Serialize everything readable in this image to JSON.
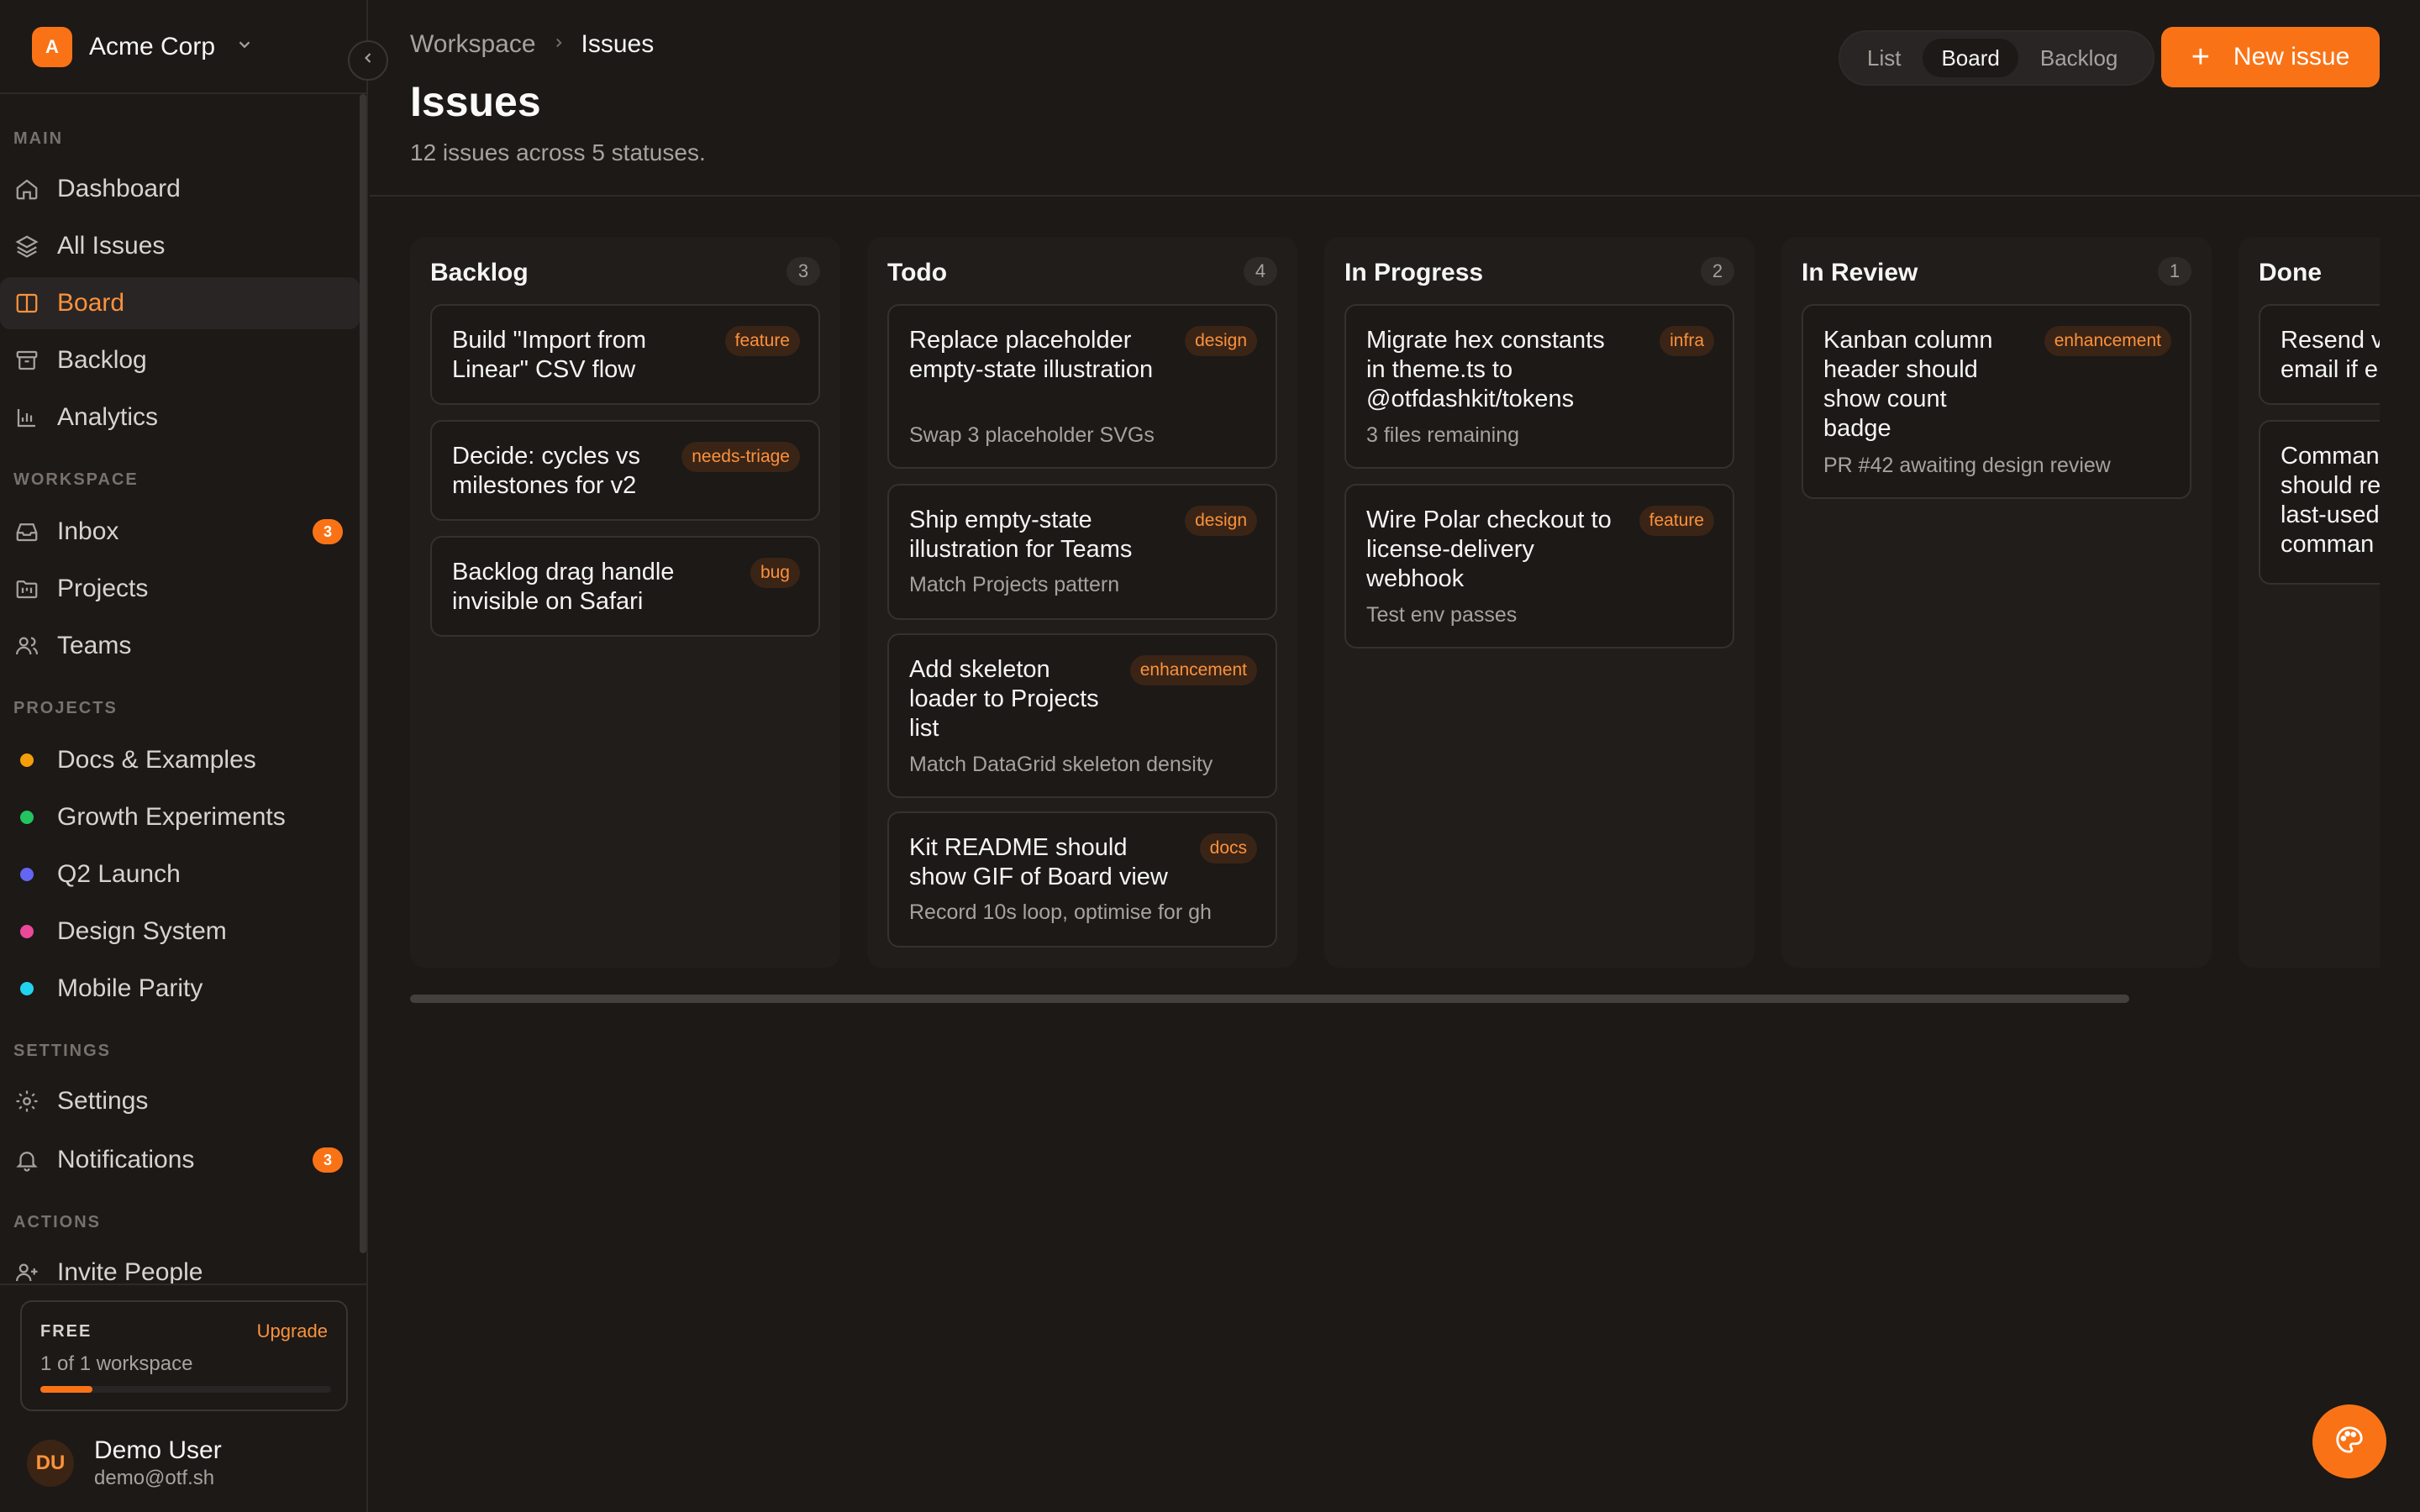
{
  "org": {
    "initial": "A",
    "name": "Acme Corp"
  },
  "sidebar": {
    "sections": {
      "main": "MAIN",
      "workspace": "WORKSPACE",
      "projects": "PROJECTS",
      "settings": "SETTINGS",
      "actions": "ACTIONS"
    },
    "main_items": [
      {
        "label": "Dashboard",
        "icon": "home-icon"
      },
      {
        "label": "All Issues",
        "icon": "layers-icon"
      },
      {
        "label": "Board",
        "icon": "board-icon",
        "active": true
      },
      {
        "label": "Backlog",
        "icon": "archive-icon"
      },
      {
        "label": "Analytics",
        "icon": "bar-chart-icon"
      }
    ],
    "workspace_items": [
      {
        "label": "Inbox",
        "icon": "inbox-icon",
        "badge": "3"
      },
      {
        "label": "Projects",
        "icon": "folder-icon"
      },
      {
        "label": "Teams",
        "icon": "users-icon"
      }
    ],
    "projects": [
      {
        "label": "Docs & Examples",
        "color": "#f59e0b"
      },
      {
        "label": "Growth Experiments",
        "color": "#22c55e"
      },
      {
        "label": "Q2 Launch",
        "color": "#6366f1"
      },
      {
        "label": "Design System",
        "color": "#ec4899"
      },
      {
        "label": "Mobile Parity",
        "color": "#22d3ee"
      }
    ],
    "settings_items": [
      {
        "label": "Settings",
        "icon": "gear-icon"
      },
      {
        "label": "Notifications",
        "icon": "bell-icon",
        "badge": "3"
      }
    ],
    "actions_items": [
      {
        "label": "Invite People",
        "icon": "user-plus-icon"
      }
    ]
  },
  "plan": {
    "tier": "FREE",
    "upgrade": "Upgrade",
    "usage": "1 of 1 workspace",
    "usage_fraction": 0.18
  },
  "user": {
    "initials": "DU",
    "name": "Demo User",
    "email": "demo@otf.sh"
  },
  "header": {
    "breadcrumb_root": "Workspace",
    "breadcrumb_current": "Issues",
    "title": "Issues",
    "subtitle": "12 issues across 5 statuses.",
    "views": [
      "List",
      "Board",
      "Backlog"
    ],
    "active_view": "Board",
    "new_issue": "New issue"
  },
  "colors": {
    "accent": "#f97316",
    "background": "#1c1917"
  },
  "board": {
    "columns": [
      {
        "title": "Backlog",
        "count": "3",
        "cards": [
          {
            "title": "Build \"Import from Linear\" CSV flow",
            "tag": "feature",
            "desc": ""
          },
          {
            "title": "Decide: cycles vs milestones for v2",
            "tag": "needs-triage",
            "desc": ""
          },
          {
            "title": "Backlog drag handle invisible on Safari",
            "tag": "bug",
            "desc": ""
          }
        ]
      },
      {
        "title": "Todo",
        "count": "4",
        "cards": [
          {
            "title": "Replace placeholder empty-state illustration",
            "tag": "design",
            "desc": "Swap 3 placeholder SVGs"
          },
          {
            "title": "Ship empty-state illustration for Teams",
            "tag": "design",
            "desc": "Match Projects pattern"
          },
          {
            "title": "Add skeleton loader to Projects list",
            "tag": "enhancement",
            "desc": "Match DataGrid skeleton density"
          },
          {
            "title": "Kit README should show GIF of Board view",
            "tag": "docs",
            "desc": "Record 10s loop, optimise for gh"
          }
        ]
      },
      {
        "title": "In Progress",
        "count": "2",
        "cards": [
          {
            "title": "Migrate hex constants in theme.ts to @otfdashkit/tokens",
            "tag": "infra",
            "desc": "3 files remaining"
          },
          {
            "title": "Wire Polar checkout to license-delivery webhook",
            "tag": "feature",
            "desc": "Test env passes"
          }
        ]
      },
      {
        "title": "In Review",
        "count": "1",
        "cards": [
          {
            "title": "Kanban column header should show count badge",
            "tag": "enhancement",
            "desc": "PR #42 awaiting design review"
          }
        ]
      },
      {
        "title": "Done",
        "count": "",
        "cards": [
          {
            "title": "Resend v email if e",
            "tag": "",
            "desc": ""
          },
          {
            "title": "Comman should re last-used comman",
            "tag": "",
            "desc": ""
          }
        ]
      }
    ]
  }
}
